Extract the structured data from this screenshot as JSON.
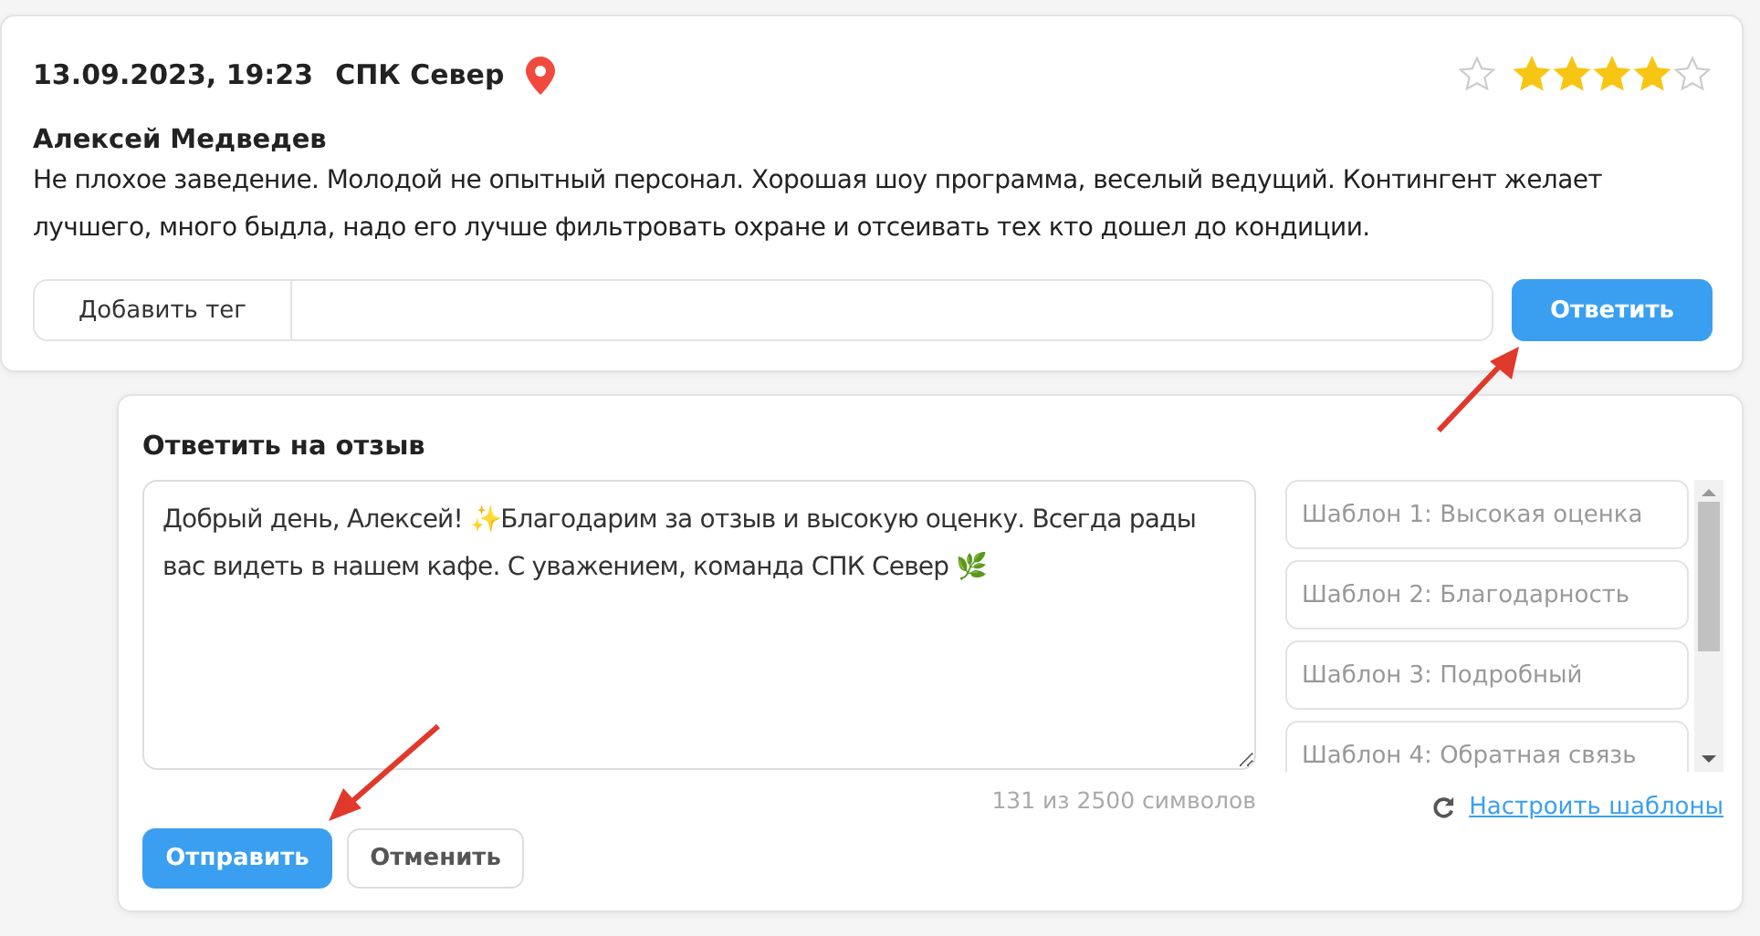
{
  "review": {
    "datetime": "13.09.2023, 19:23",
    "place": "СПК Север",
    "favorite": false,
    "stars": 4,
    "author": "Алексей Медведев",
    "text": "Не плохое заведение. Молодой не опытный персонал. Хорошая шоу программа, веселый ведущий. Контингент желает лучшего, много быдла, надо его лучше фильтровать охране и отсеивать тех кто дошел до кондиции.",
    "tag_button": "Добавить тег",
    "reply_button": "Ответить"
  },
  "reply_form": {
    "title": "Ответить на отзыв",
    "value": "Добрый день, Алексей! ✨Благодарим за отзыв и высокую оценку. Всегда рады вас видеть в нашем кафе. С уважением, команда СПК Север 🌿",
    "counter": "131 из 2500 символов",
    "templates": [
      "Шаблон 1: Высокая оценка",
      "Шаблон 2: Благодарность",
      "Шаблон 3: Подробный",
      "Шаблон 4: Обратная связь"
    ],
    "configure_link": "Настроить шаблоны",
    "send_button": "Отправить",
    "cancel_button": "Отменить"
  }
}
